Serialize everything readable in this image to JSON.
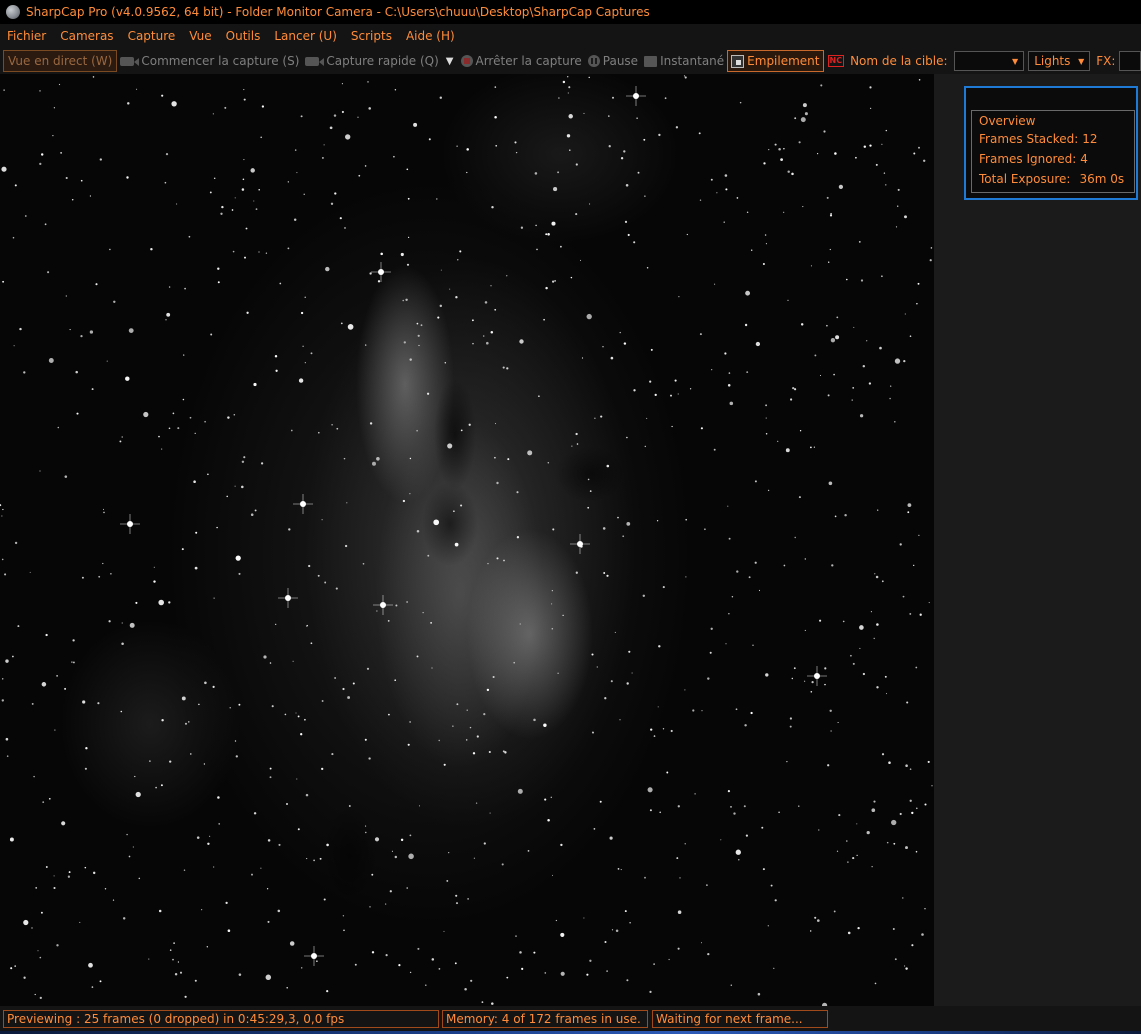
{
  "window": {
    "title": "SharpCap Pro (v4.0.9562, 64 bit) - Folder Monitor Camera - C:\\Users\\chuuu\\Desktop\\SharpCap Captures"
  },
  "menu": [
    "Fichier",
    "Cameras",
    "Capture",
    "Vue",
    "Outils",
    "Lancer (U)",
    "Scripts",
    "Aide (H)"
  ],
  "toolbar": {
    "live_view": "Vue en direct (W)",
    "start_capture": "Commencer la capture (S)",
    "quick_capture": "Capture rapide (Q)",
    "stop_capture": "Arrêter la capture",
    "pause": "Pause",
    "snapshot": "Instantané",
    "stacking": "Empilement",
    "nc_badge": "NC",
    "target_name_label": "Nom de la cible:",
    "target_name_value": "",
    "frame_type_value": "Lights",
    "fx_label": "FX:"
  },
  "overview": {
    "title": "Overview",
    "frames_stacked_label": "Frames Stacked:",
    "frames_stacked_value": "12",
    "frames_ignored_label": "Frames Ignored:",
    "frames_ignored_value": "4",
    "total_exposure_label": "Total Exposure:",
    "total_exposure_value": "36m 0s"
  },
  "status": {
    "previewing": "Previewing : 25 frames (0 dropped) in 0:45:29,3, 0,0 fps",
    "memory": "Memory: 4 of 172 frames in use.",
    "waiting": "Waiting for next frame..."
  },
  "colors": {
    "accent_orange": "#ff8c3a",
    "panel_highlight_blue": "#1f7ad6",
    "background": "#1b1b1b"
  }
}
